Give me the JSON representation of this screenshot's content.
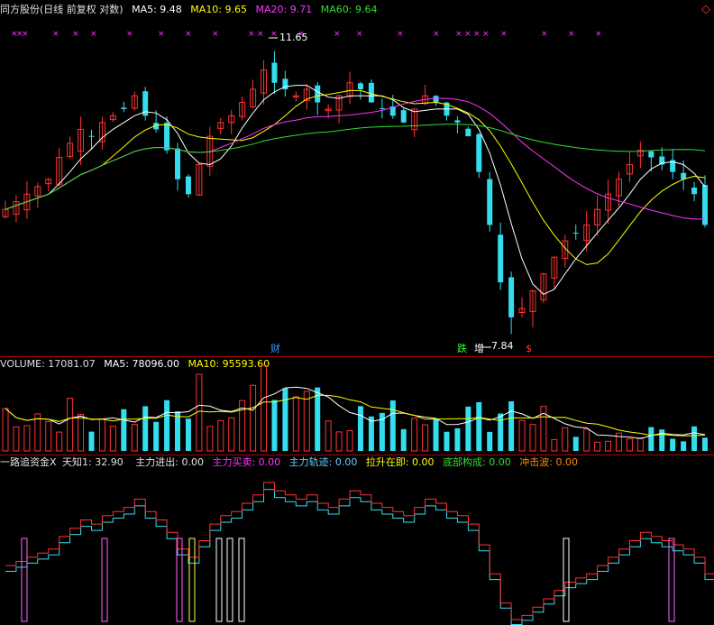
{
  "main_header": {
    "stock": "同方股份(日线 前复权 对数)",
    "ma5": "MA5: 9.48",
    "ma10": "MA10: 9.65",
    "ma20": "MA20: 9.71",
    "ma60": "MA60: 9.64",
    "colors": {
      "stock": "#e0e0e0",
      "ma5": "#ffffff",
      "ma10": "#ffff00",
      "ma20": "#ff33ff",
      "ma60": "#33dd33"
    }
  },
  "price_labels": {
    "high": "11.65",
    "low": "7.84"
  },
  "event_markers": [
    {
      "text": "财",
      "color": "#3399ff"
    },
    {
      "text": "跌",
      "color": "#33ff33"
    },
    {
      "text": "增",
      "color": "#ffffff"
    },
    {
      "text": "$",
      "color": "#ff3333"
    }
  ],
  "x_marks": "×",
  "volume_header": {
    "volume": "VOLUME: 17081.07",
    "ma5": "MA5: 78096.00",
    "ma10": "MA10: 95593.60"
  },
  "indicator_header": {
    "name": "一路追资金X",
    "tianzhi": "天知1: 32.90",
    "zhuli_jinchu": "主力进出: 0.00",
    "zhuli_maimai": "主力买卖: 0.00",
    "zhuli_guiji": "主力轨迹: 0.00",
    "lasheng": "拉升在即: 0.00",
    "dibu": "底部构成: 0.00",
    "chongji": "冲击波: 0.00"
  },
  "chart_data": {
    "type": "candlestick",
    "title": "同方股份(日线 前复权 对数)",
    "y_labels_shown": {
      "high": 11.65,
      "low": 7.84
    },
    "close_approx": [
      9.2,
      9.3,
      9.4,
      9.5,
      9.6,
      9.9,
      10.1,
      10.3,
      10.2,
      10.4,
      10.5,
      10.6,
      10.8,
      10.5,
      10.3,
      10.0,
      9.6,
      9.4,
      9.8,
      10.2,
      10.4,
      10.5,
      10.7,
      10.9,
      11.2,
      11.0,
      10.9,
      10.8,
      10.9,
      10.7,
      10.6,
      10.8,
      11.0,
      10.9,
      10.7,
      10.6,
      10.5,
      10.4,
      10.6,
      10.8,
      10.7,
      10.5,
      10.4,
      10.2,
      9.7,
      9.0,
      8.3,
      7.9,
      8.0,
      8.2,
      8.4,
      8.6,
      8.8,
      8.9,
      9.0,
      9.2,
      9.4,
      9.6,
      9.8,
      10.0,
      9.9,
      9.8,
      9.7,
      9.6,
      9.4,
      9.0
    ]
  }
}
